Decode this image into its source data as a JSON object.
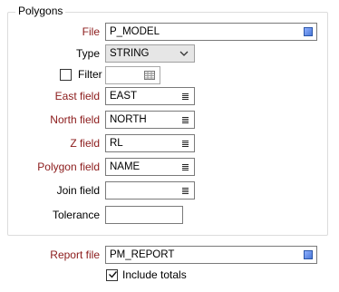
{
  "polygons": {
    "group_title": "Polygons",
    "file_label": "File",
    "file_value": "P_MODEL",
    "type_label": "Type",
    "type_value": "STRING",
    "filter_label": "Filter",
    "east_label": "East field",
    "east_value": "EAST",
    "north_label": "North field",
    "north_value": "NORTH",
    "z_label": "Z field",
    "z_value": "RL",
    "polygon_label": "Polygon field",
    "polygon_value": "NAME",
    "join_label": "Join field",
    "join_value": "",
    "tolerance_label": "Tolerance",
    "tolerance_value": ""
  },
  "report": {
    "file_label": "Report file",
    "file_value": "PM_REPORT",
    "include_totals_label": "Include totals",
    "include_totals_checked": true
  },
  "icons": {
    "file_picker": "file-picker-icon",
    "list_picker": "list-picker-icon",
    "dropdown": "chevron-down-icon",
    "filter": "filter-table-icon",
    "check": "check-icon"
  },
  "colors": {
    "required_label": "#8b1a1a",
    "picker_blue": "#4b78d8"
  }
}
